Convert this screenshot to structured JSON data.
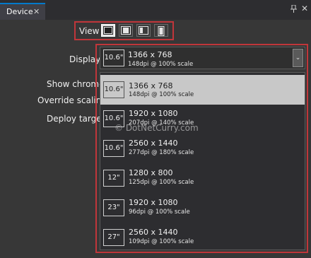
{
  "tab": {
    "title": "Device",
    "close_glyph": "✕"
  },
  "window": {
    "pin_glyph": "🖈",
    "close_glyph": "✕"
  },
  "view": {
    "label": "View",
    "buttons": [
      {
        "icon": "monitor-landscape-icon",
        "active": true
      },
      {
        "icon": "screen-landscape-icon",
        "active": false
      },
      {
        "icon": "screen-split-icon",
        "active": false
      },
      {
        "icon": "screen-portrait-icon",
        "active": false
      }
    ]
  },
  "labels": {
    "display": "Display",
    "show_chrome": "Show chrome",
    "override_scaling": "Override scaling",
    "deploy_target": "Deploy target"
  },
  "display": {
    "selected": {
      "size": "10.6\"",
      "resolution": "1366 x 768",
      "dpi": "148dpi @ 100% scale"
    },
    "options": [
      {
        "size": "10.6\"",
        "resolution": "1366 x 768",
        "dpi": "148dpi @ 100% scale",
        "selected": true
      },
      {
        "size": "10.6\"",
        "resolution": "1920 x 1080",
        "dpi": "207dpi @ 140% scale",
        "selected": false
      },
      {
        "size": "10.6\"",
        "resolution": "2560 x 1440",
        "dpi": "277dpi @ 180% scale",
        "selected": false
      },
      {
        "size": "12\"",
        "resolution": "1280 x 800",
        "dpi": "125dpi @ 100% scale",
        "selected": false
      },
      {
        "size": "23\"",
        "resolution": "1920 x 1080",
        "dpi": "96dpi @ 100% scale",
        "selected": false
      },
      {
        "size": "27\"",
        "resolution": "2560 x 1440",
        "dpi": "109dpi @ 100% scale",
        "selected": false
      }
    ]
  },
  "watermark": "© DotNetCurry.com",
  "colors": {
    "accent": "#007acc",
    "highlight": "#c0363a",
    "selected_row": "#c8c8c8"
  }
}
